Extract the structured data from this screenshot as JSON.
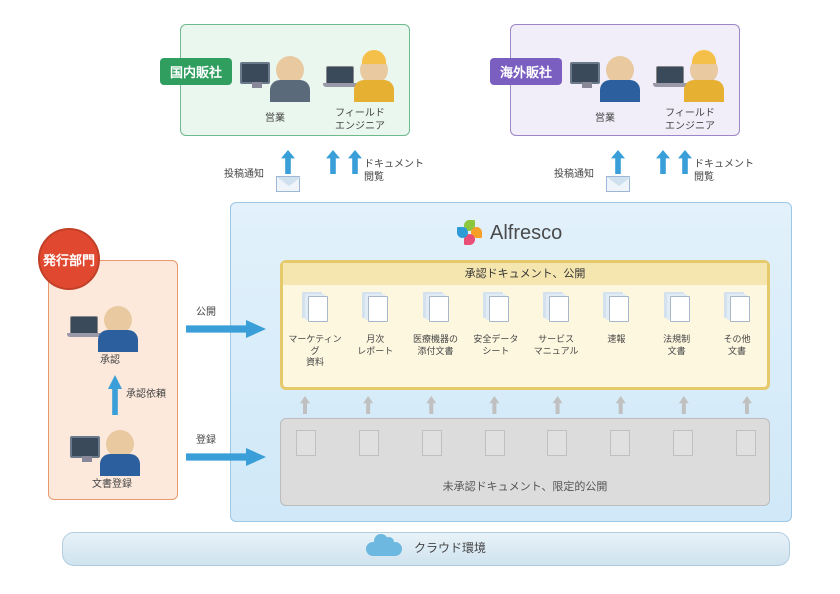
{
  "top": {
    "domestic": {
      "tag": "国内販社",
      "sales": "営業",
      "engineer": "フィールド\nエンジニア"
    },
    "overseas": {
      "tag": "海外販社",
      "sales": "営業",
      "engineer": "フィールド\nエンジニア"
    },
    "post_notify": "投稿通知",
    "doc_view": "ドキュメント\n閲覧"
  },
  "publisher": {
    "badge": "発行部門",
    "approve": "承認",
    "approval_request": "承認依頼",
    "register": "文書登録",
    "publish_label": "公開",
    "register_label": "登録"
  },
  "alfresco": {
    "brand": "Alfresco",
    "approved_title": "承認ドキュメント、公開",
    "unapproved_title": "未承認ドキュメント、限定的公開",
    "docs": [
      "マーケティング\n資料",
      "月次\nレポート",
      "医療機器の\n添付文書",
      "安全データ\nシート",
      "サービス\nマニュアル",
      "速報",
      "法規制\n文書",
      "その他\n文書"
    ]
  },
  "cloud": "クラウド環境"
}
